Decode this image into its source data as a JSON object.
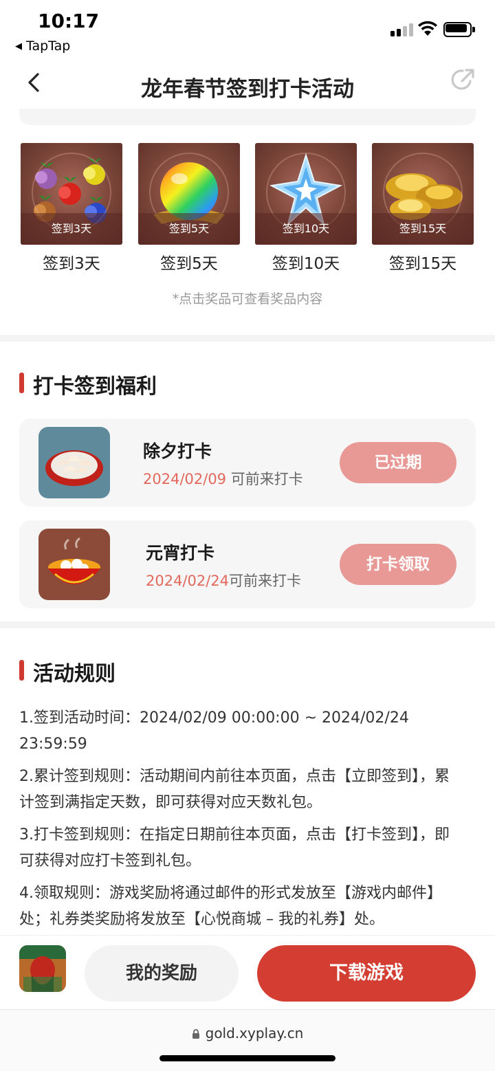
{
  "status_bar": {
    "time": "10:17",
    "back_app": "TapTap"
  },
  "nav": {
    "title": "龙年春节签到打卡活动"
  },
  "rewards": {
    "items": [
      {
        "tag": "签到3天",
        "label": "签到3天"
      },
      {
        "tag": "签到5天",
        "label": "签到5天"
      },
      {
        "tag": "签到10天",
        "label": "签到10天"
      },
      {
        "tag": "签到15天",
        "label": "签到15天"
      }
    ],
    "hint": "*点击奖品可查看奖品内容"
  },
  "checkin": {
    "title": "打卡签到福利",
    "items": [
      {
        "name": "除夕打卡",
        "date": "2024/02/09",
        "suffix": " 可前来打卡",
        "button": "已过期"
      },
      {
        "name": "元宵打卡",
        "date": "2024/02/24",
        "suffix": "可前来打卡",
        "button": "打卡领取"
      }
    ]
  },
  "rules": {
    "title": "活动规则",
    "lines": [
      "1.签到活动时间：2024/02/09 00:00:00 ~ 2024/02/24 23:59:59",
      "2.累计签到规则：活动期间内前往本页面，点击【立即签到】，累计签到满指定天数，即可获得对应天数礼包。",
      "3.打卡签到规则：在指定日期前往本页面，点击【打卡签到】，即可获得对应打卡签到礼包。",
      "4.领取规则：游戏奖励将通过邮件的形式发放至【游戏内邮件】处；礼券类奖励将发放至【心悦商城 – 我的礼券】处。"
    ]
  },
  "bottom_bar": {
    "my_rewards": "我的奖励",
    "download": "下载游戏"
  },
  "url_bar": {
    "url": "gold.xyplay.cn"
  },
  "colors": {
    "accent": "#d43d31",
    "button_soft": "#e89995",
    "date": "#e2685c"
  }
}
